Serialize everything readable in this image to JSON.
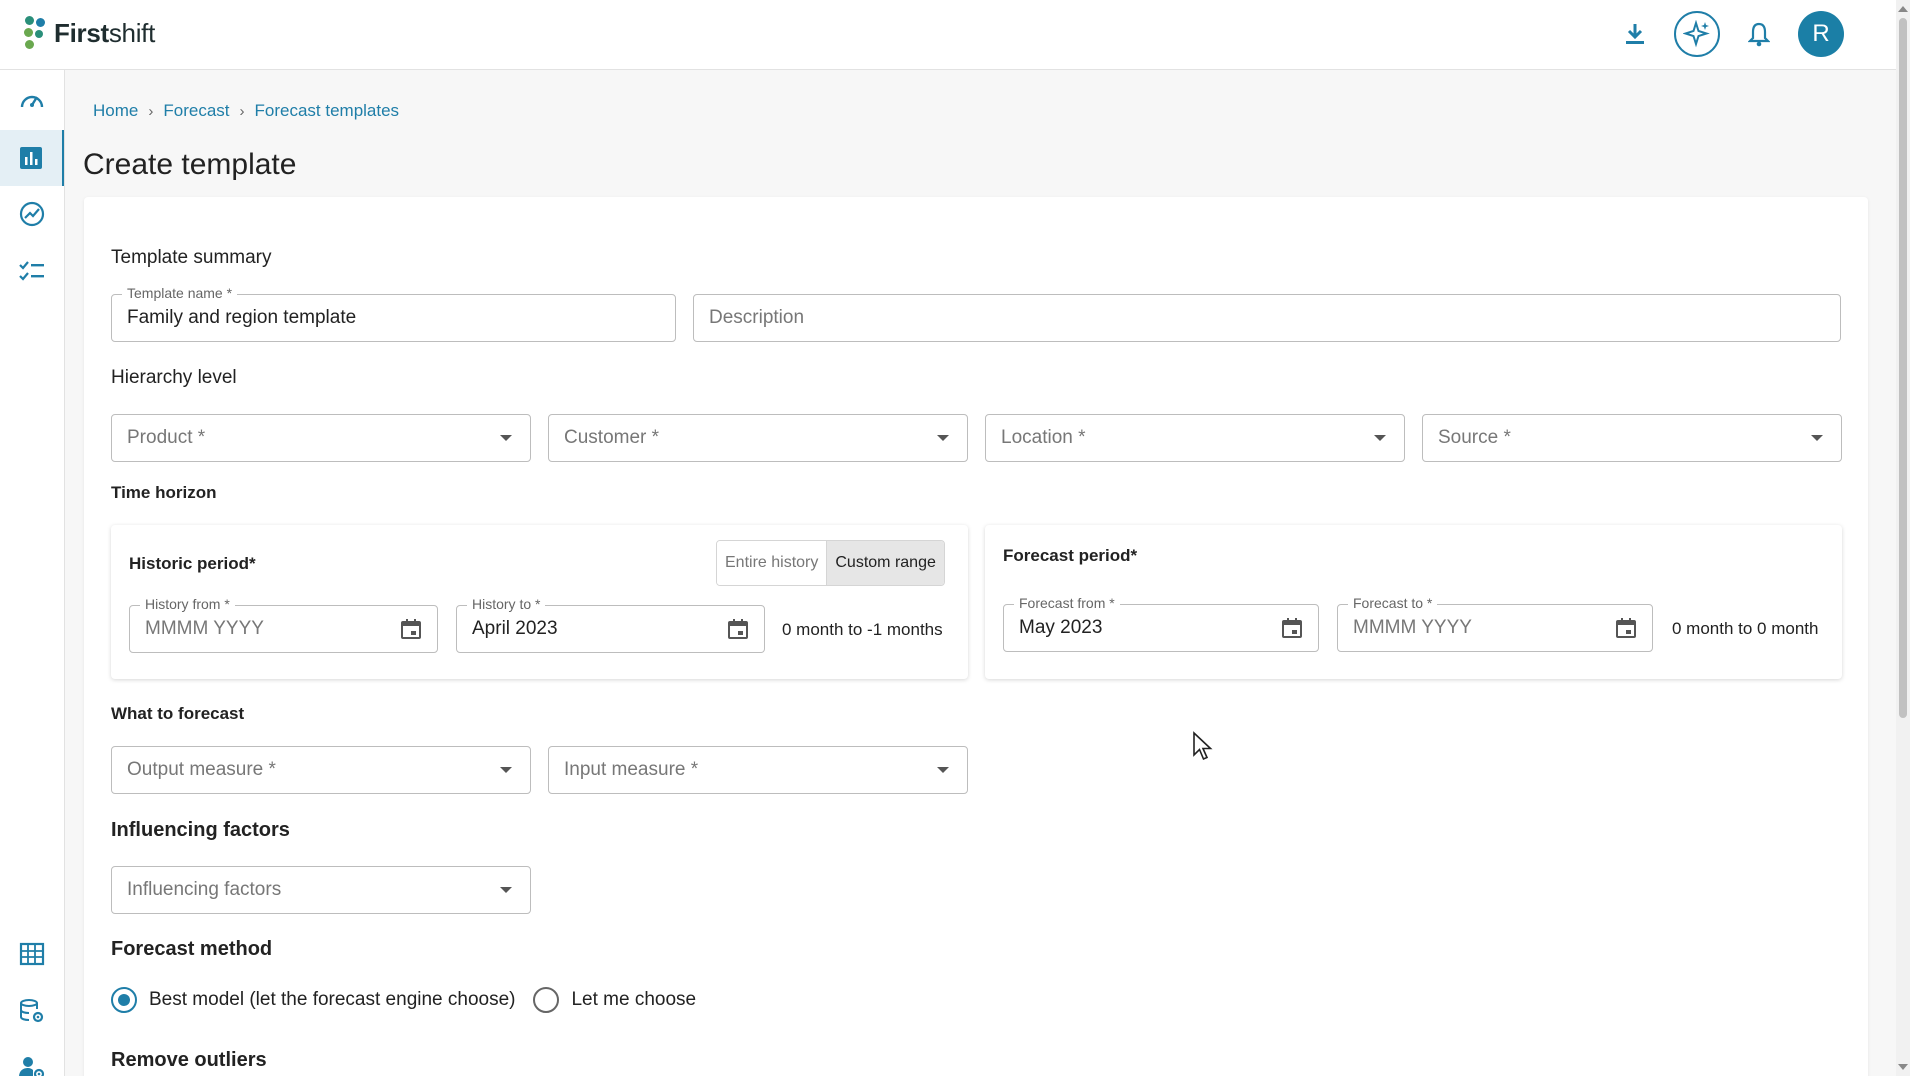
{
  "brand": {
    "name_bold": "First",
    "name_regular": "shift"
  },
  "header": {
    "avatar_letter": "R"
  },
  "breadcrumb": {
    "items": [
      "Home",
      "Forecast",
      "Forecast templates"
    ],
    "separator": "›"
  },
  "page": {
    "title": "Create template"
  },
  "summary": {
    "label": "Template summary",
    "template_name_label": "Template name *",
    "template_name_value": "Family and region template",
    "description_placeholder": "Description"
  },
  "hierarchy": {
    "label": "Hierarchy level",
    "product": "Product *",
    "customer": "Customer *",
    "location": "Location *",
    "source": "Source *"
  },
  "time_horizon": {
    "label": "Time horizon",
    "historic": {
      "title": "Historic period*",
      "toggle_entire": "Entire history",
      "toggle_custom": "Custom range",
      "from_label": "History from *",
      "from_placeholder": "MMMM YYYY",
      "to_label": "History to *",
      "to_value": "April 2023",
      "range_text": "0 month to -1 months"
    },
    "forecast": {
      "title": "Forecast period*",
      "from_label": "Forecast from *",
      "from_value": "May 2023",
      "to_label": "Forecast to *",
      "to_placeholder": "MMMM YYYY",
      "range_text": "0 month to 0 month"
    }
  },
  "what_to_forecast": {
    "label": "What to forecast",
    "output_measure": "Output measure *",
    "input_measure": "Input measure *"
  },
  "influencing": {
    "label": "Influencing factors",
    "placeholder": "Influencing factors"
  },
  "method": {
    "label": "Forecast method",
    "option_best": "Best model (let the forecast engine choose)",
    "option_choose": "Let me choose",
    "selected": "best"
  },
  "outliers": {
    "label": "Remove outliers"
  },
  "colors": {
    "accent": "#1f7ea8",
    "avatar": "#1b7fa6"
  }
}
